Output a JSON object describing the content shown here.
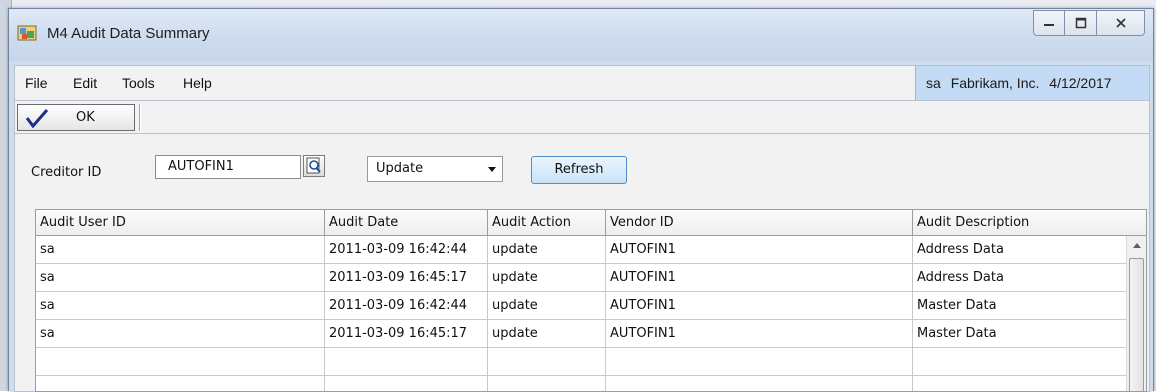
{
  "window": {
    "title": "M4 Audit Data Summary",
    "minimize_icon": "minimize-icon",
    "maximize_icon": "maximize-icon",
    "close_icon": "close-icon"
  },
  "menu": {
    "items": [
      "File",
      "Edit",
      "Tools",
      "Help"
    ]
  },
  "userbar": {
    "user": "sa",
    "company": "Fabrikam, Inc.",
    "date": "4/12/2017"
  },
  "toolbar": {
    "ok_label": "OK",
    "ok_icon": "checkmark-icon"
  },
  "filters": {
    "creditor_label": "Creditor ID",
    "creditor_value": "AUTOFIN1",
    "lookup_icon": "lookup-icon",
    "action_value": "Update",
    "refresh_label": "Refresh"
  },
  "grid": {
    "columns": [
      "Audit User ID",
      "Audit Date",
      "Audit Action",
      "Vendor ID",
      "Audit Description"
    ],
    "rows": [
      [
        "sa",
        "2011-03-09 16:42:44",
        "update",
        "AUTOFIN1",
        "Address Data"
      ],
      [
        "sa",
        "2011-03-09 16:45:17",
        "update",
        "AUTOFIN1",
        "Address Data"
      ],
      [
        "sa",
        "2011-03-09 16:42:44",
        "update",
        "AUTOFIN1",
        "Master Data"
      ],
      [
        "sa",
        "2011-03-09 16:45:17",
        "update",
        "AUTOFIN1",
        "Master Data"
      ],
      [
        "",
        "",
        "",
        "",
        ""
      ],
      [
        "",
        "",
        "",
        "",
        ""
      ]
    ]
  },
  "colors": {
    "title_bg": "#cddbee",
    "userbar_bg": "#c3dbf4",
    "refresh_border": "#4e8fc8"
  }
}
